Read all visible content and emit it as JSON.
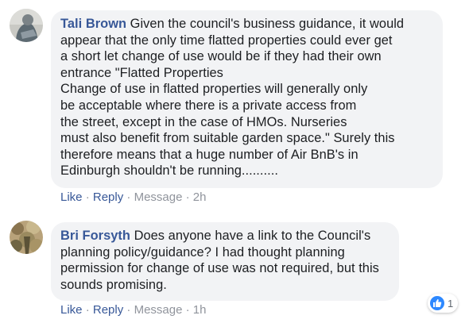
{
  "comments": [
    {
      "author": "Tali Brown",
      "text_lines": [
        "Given the council's business guidance, it would",
        "appear that the only time flatted properties could ever get",
        "a short let change of use would be if they had their own",
        "entrance \"Flatted Properties",
        "Change of use in flatted properties will generally only",
        "be acceptable where there is a private access from",
        "the street, except in the case of HMOs. Nurseries",
        "must also benefit from suitable garden space.\" Surely this",
        "therefore means that a huge number of Air BnB's in",
        "Edinburgh shouldn't be running.........."
      ],
      "actions": {
        "like": "Like",
        "reply": "Reply",
        "message": "Message",
        "time": "2h",
        "separator": "·"
      }
    },
    {
      "author": "Bri Forsyth",
      "text_lines": [
        "Does anyone have a link to the Council's",
        "planning policy/guidance? I had thought planning",
        "permission for change of use was not required, but this",
        "sounds promising."
      ],
      "actions": {
        "like": "Like",
        "reply": "Reply",
        "message": "Message",
        "time": "1h",
        "separator": "·"
      },
      "reaction": {
        "icon": "thumbs-up-icon",
        "count": "1",
        "color": "#2d88ff"
      }
    }
  ],
  "colors": {
    "author": "#385898",
    "bubble": "#f2f3f5",
    "meta": "#90949c",
    "text": "#1c1e21"
  }
}
